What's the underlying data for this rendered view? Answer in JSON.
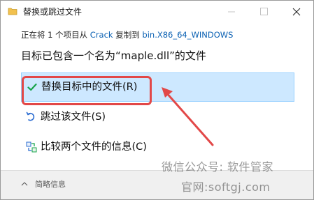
{
  "window": {
    "title": "替换或跳过文件",
    "minimize_icon": "minimize-icon",
    "maximize_icon": "maximize-icon",
    "close_icon": "close-icon"
  },
  "source_line": {
    "prefix": "正在将 1 个项目从",
    "source_folder": "Crack",
    "middle": "复制到",
    "destination_folder": "bin.X86_64_WINDOWS"
  },
  "heading": "目标已包含一个名为“maple.dll”的文件",
  "options": [
    {
      "label": "替换目标中的文件(R)",
      "icon": "checkmark-icon",
      "selected": true
    },
    {
      "label": "跳过该文件(S)",
      "icon": "skip-icon",
      "selected": false
    },
    {
      "label": "比较两个文件的信息(C)",
      "icon": "compare-icon",
      "selected": false
    }
  ],
  "footer": {
    "label": "简略信息",
    "icon": "chevron-up-icon"
  },
  "annotation": {
    "box_color": "#e24848",
    "arrow_color": "#e24848"
  },
  "watermark": {
    "line1": "微信公众号: 软件管家",
    "line2": "官网:softgj.com"
  },
  "colors": {
    "accent": "#0b61b3",
    "selected_bg": "#cde8ff",
    "selected_border": "#99d1ff",
    "check_green": "#16a34a"
  }
}
